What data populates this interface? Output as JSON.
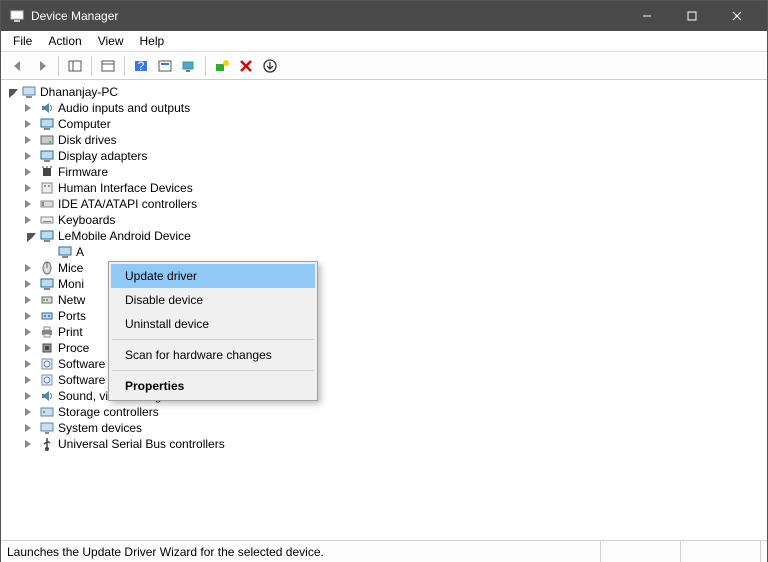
{
  "window": {
    "title": "Device Manager"
  },
  "menubar": [
    "File",
    "Action",
    "View",
    "Help"
  ],
  "tree": {
    "root": {
      "label": "Dhananjay-PC",
      "expanded": true
    },
    "children": [
      {
        "label": "Audio inputs and outputs",
        "icon": "speaker",
        "expanded": false
      },
      {
        "label": "Computer",
        "icon": "monitor",
        "expanded": false
      },
      {
        "label": "Disk drives",
        "icon": "disk",
        "expanded": false
      },
      {
        "label": "Display adapters",
        "icon": "monitor",
        "expanded": false
      },
      {
        "label": "Firmware",
        "icon": "chip",
        "expanded": false
      },
      {
        "label": "Human Interface Devices",
        "icon": "hid",
        "expanded": false
      },
      {
        "label": "IDE ATA/ATAPI controllers",
        "icon": "ide",
        "expanded": false
      },
      {
        "label": "Keyboards",
        "icon": "keyboard",
        "expanded": false
      },
      {
        "label": "LeMobile Android Device",
        "icon": "monitor",
        "expanded": true,
        "children": [
          {
            "label": "A",
            "icon": "monitor"
          }
        ]
      },
      {
        "label": "Mice",
        "icon": "mouse",
        "expanded": false,
        "truncated": true
      },
      {
        "label": "Moni",
        "icon": "monitor",
        "expanded": false,
        "truncated": true
      },
      {
        "label": "Netw",
        "icon": "network",
        "expanded": false,
        "truncated": true
      },
      {
        "label": "Ports",
        "icon": "port",
        "expanded": false,
        "truncated": true
      },
      {
        "label": "Print",
        "icon": "printer",
        "expanded": false,
        "truncated": true
      },
      {
        "label": "Proce",
        "icon": "cpu",
        "expanded": false,
        "truncated": true
      },
      {
        "label": "Software components",
        "icon": "software",
        "expanded": false
      },
      {
        "label": "Software devices",
        "icon": "software",
        "expanded": false
      },
      {
        "label": "Sound, video and game controllers",
        "icon": "speaker",
        "expanded": false
      },
      {
        "label": "Storage controllers",
        "icon": "storage",
        "expanded": false
      },
      {
        "label": "System devices",
        "icon": "system",
        "expanded": false
      },
      {
        "label": "Universal Serial Bus controllers",
        "icon": "usb",
        "expanded": false
      }
    ]
  },
  "context_menu": {
    "items": [
      {
        "label": "Update driver",
        "highlight": true
      },
      {
        "label": "Disable device"
      },
      {
        "label": "Uninstall device"
      },
      {
        "sep": true
      },
      {
        "label": "Scan for hardware changes"
      },
      {
        "sep": true
      },
      {
        "label": "Properties",
        "bold": true
      }
    ]
  },
  "statusbar": {
    "text": "Launches the Update Driver Wizard for the selected device."
  }
}
